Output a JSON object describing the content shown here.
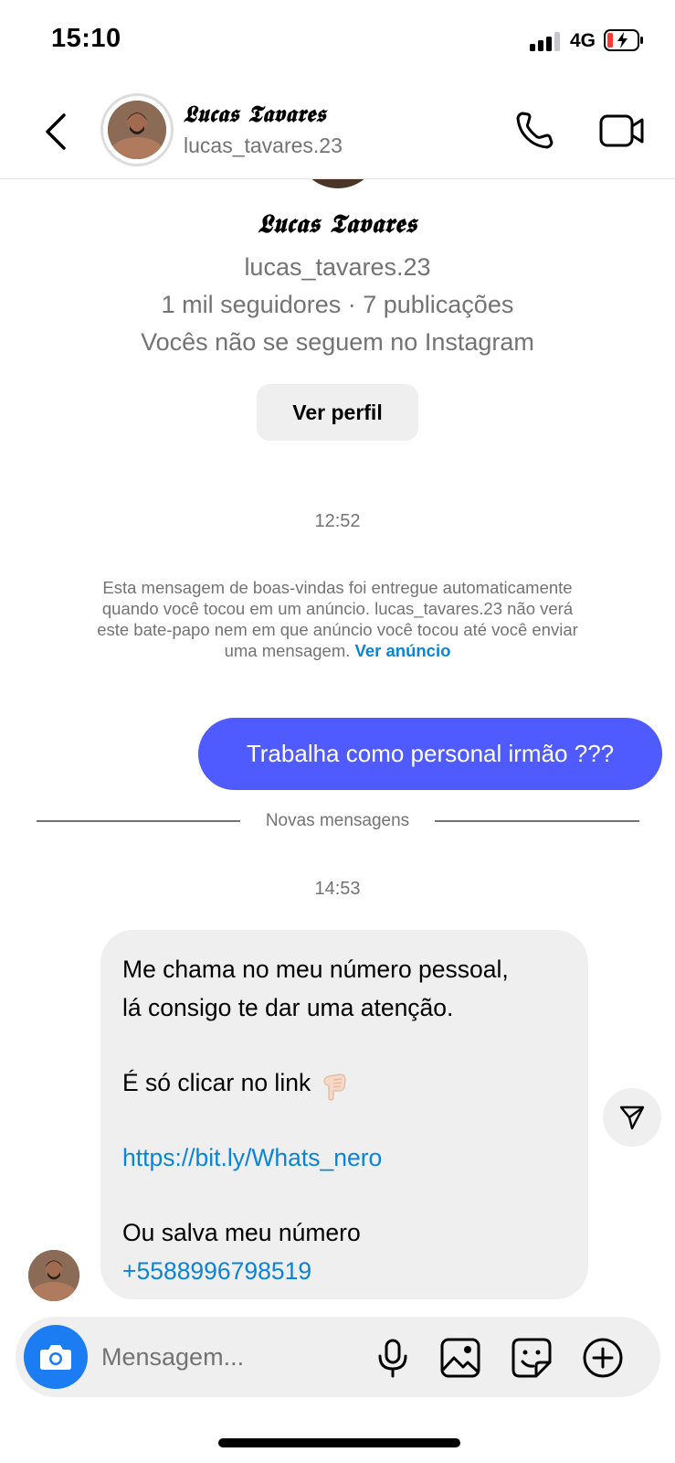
{
  "status_bar": {
    "time": "15:10",
    "network": "4G",
    "signal_bars": 3,
    "battery_charging": true
  },
  "header": {
    "name": "𝕷𝖚𝖈𝖆𝖘 𝕿𝖆𝖛𝖆𝖗𝖊𝖘",
    "username": "lucas_tavares.23"
  },
  "profile": {
    "name": "𝕷𝖚𝖈𝖆𝖘 𝕿𝖆𝖛𝖆𝖗𝖊𝖘",
    "username": "lucas_tavares.23",
    "stats": "1 mil seguidores · 7 publicações",
    "follow_status": "Vocês não se seguem no Instagram",
    "view_profile_label": "Ver perfil"
  },
  "thread": {
    "timestamp_1": "12:52",
    "system_message": "Esta mensagem de boas-vindas foi entregue automaticamente quando você tocou em um anúncio. lucas_tavares.23 não verá este bate-papo nem em que anúncio você tocou até você enviar uma mensagem.",
    "system_link": "Ver anúncio",
    "outgoing_message": "Trabalha como personal irmão ???",
    "divider_label": "Novas mensagens",
    "timestamp_2": "14:53",
    "incoming": {
      "line1": "Me chama no meu número pessoal,",
      "line2": "lá consigo te dar uma atenção.",
      "line3": "É só clicar no link",
      "link": "https://bit.ly/Whats_nero",
      "line4": "Ou salva meu número",
      "phone": "+5588996798519"
    }
  },
  "composer": {
    "placeholder": "Mensagem..."
  },
  "colors": {
    "outgoing_bubble": "#4f5bff",
    "incoming_bubble": "#efeff0",
    "link": "#0a84d6",
    "camera_button": "#1c7cf2",
    "secondary_text": "#737373"
  },
  "icons": [
    "back-icon",
    "call-icon",
    "video-icon",
    "send-icon",
    "camera-icon",
    "microphone-icon",
    "gallery-icon",
    "sticker-icon",
    "plus-icon",
    "hand-pointing-down-icon"
  ]
}
